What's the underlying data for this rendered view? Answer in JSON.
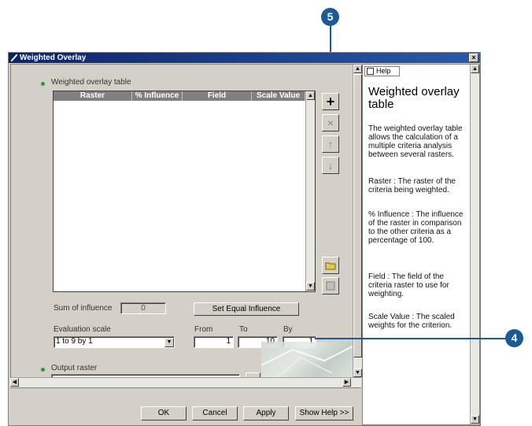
{
  "window": {
    "title": "Weighted Overlay",
    "close_label": "×"
  },
  "callouts": {
    "top": "5",
    "right": "4"
  },
  "table_section": {
    "label": "Weighted overlay table",
    "columns": [
      "Raster",
      "% Influence",
      "Field",
      "Scale Value"
    ]
  },
  "toolbar": {
    "add": "+",
    "remove": "×",
    "up": "↑",
    "down": "↓"
  },
  "influence": {
    "sum_label": "Sum of influence",
    "sum_value": "0",
    "equal_button": "Set Equal Influence"
  },
  "scale": {
    "eval_label": "Evaluation scale",
    "eval_value": "1 to 9 by 1",
    "from_label": "From",
    "from_value": "1",
    "to_label": "To",
    "to_value": "10",
    "by_label": "By",
    "by_value": "1"
  },
  "output": {
    "label": "Output raster",
    "value": ""
  },
  "buttons": {
    "ok": "OK",
    "cancel": "Cancel",
    "apply": "Apply",
    "show_help": "Show Help >>"
  },
  "help": {
    "tab": "Help",
    "title": "Weighted overlay table",
    "paragraphs": [
      "The weighted overlay table allows the calculation of a multiple criteria analysis between several rasters.",
      "Raster : The raster of the criteria being weighted.",
      "% Influence : The influence of the raster in comparison to the other criteria as a percentage of 100.",
      "Field : The field of the criteria raster to use for weighting.",
      "Scale Value : The scaled weights for the criterion."
    ]
  },
  "colors": {
    "accent": "#1b5a94",
    "title_bar": "#0a246a",
    "bullet": "#2d9a3a"
  }
}
